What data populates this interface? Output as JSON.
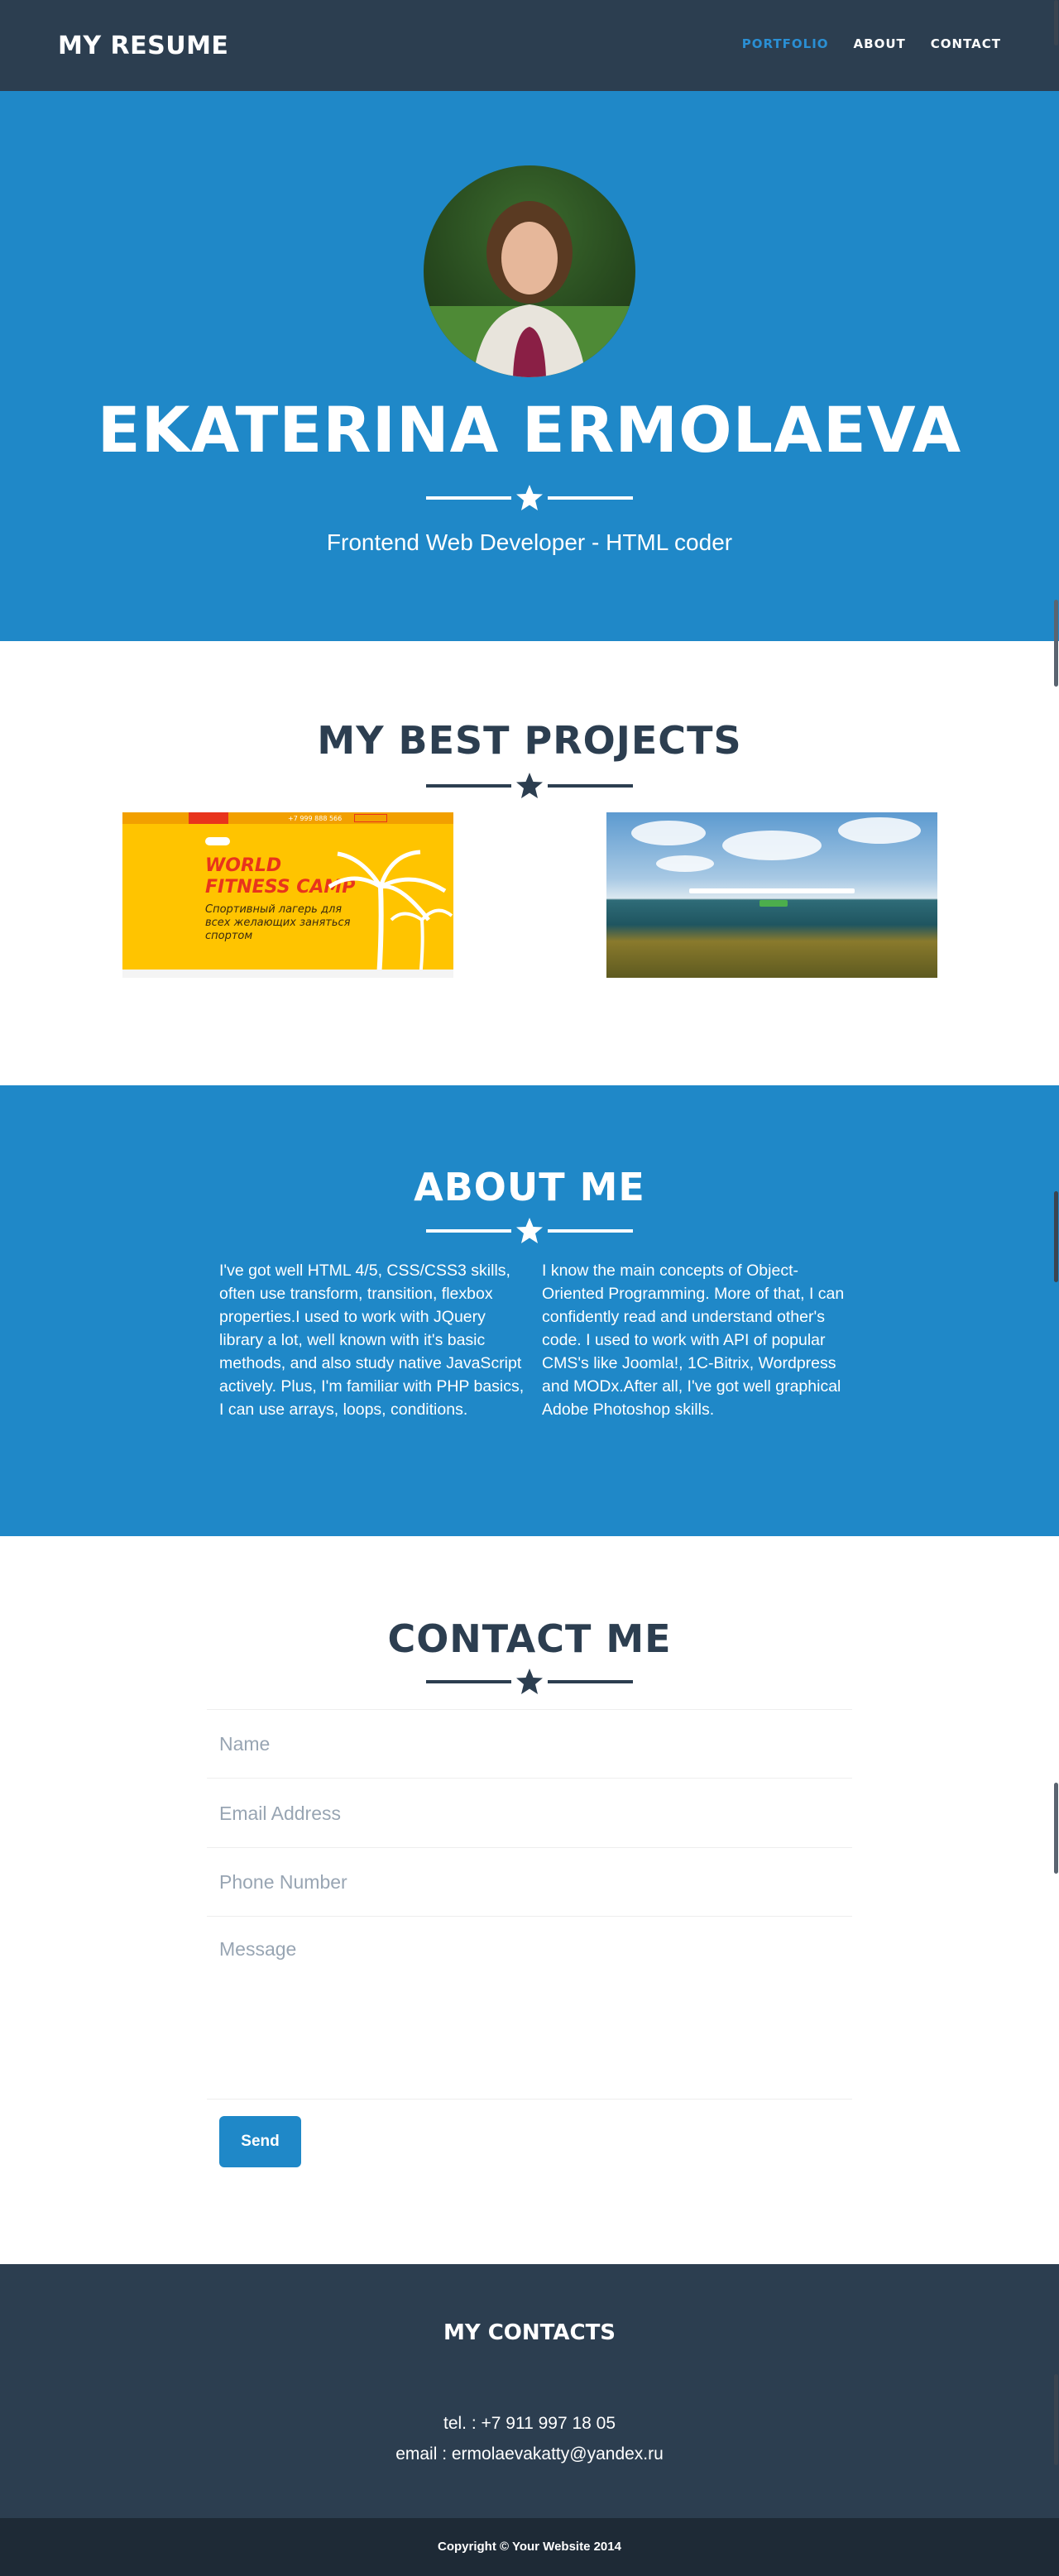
{
  "navbar": {
    "brand": "MY RESUME",
    "links": [
      "PORTFOLIO",
      "ABOUT",
      "CONTACT"
    ],
    "active": "PORTFOLIO"
  },
  "hero": {
    "name": "EKATERINA ERMOLAEVA",
    "subtitle": "Frontend Web Developer - HTML coder"
  },
  "portfolio": {
    "title": "MY BEST PROJECTS",
    "projects": [
      {
        "phone": "+7 999 888 566",
        "title_line1": "WORLD",
        "title_line2": "FITNESS CAMP",
        "subtitle": "Спортивный лагерь для всех желающих заняться спортом"
      },
      {}
    ]
  },
  "about": {
    "title": "ABOUT ME",
    "left": "I've got well HTML 4/5, CSS/CSS3 skills, often use transform, transition, flexbox properties.I used to work with JQuery library a lot, well known with it's basic methods, and also study native JavaScript actively. Plus, I'm familiar with PHP basics, I can use arrays, loops, conditions.",
    "right": "I know the main concepts of Object-Oriented Programming. More of that, I can confidently read and understand other's code. I used to work with API of popular CMS's like Joomla!, 1C-Bitrix, Wordpress and MODx.After all, I've got well graphical Adobe Photoshop skills."
  },
  "contact": {
    "title": "CONTACT ME",
    "name_placeholder": "Name",
    "email_placeholder": "Email Address",
    "phone_placeholder": "Phone Number",
    "message_placeholder": "Message",
    "send_label": "Send"
  },
  "footer": {
    "title": "MY CONTACTS",
    "tel": "tel. : +7 911 997 18 05",
    "email": "email : ermolaevakatty@yandex.ru",
    "copyright": "Copyright © Your Website 2014"
  },
  "colors": {
    "primary": "#1f88c8",
    "dark": "#2c3e50",
    "darker": "#1e2a36",
    "accent_active": "#2a8fd4"
  }
}
